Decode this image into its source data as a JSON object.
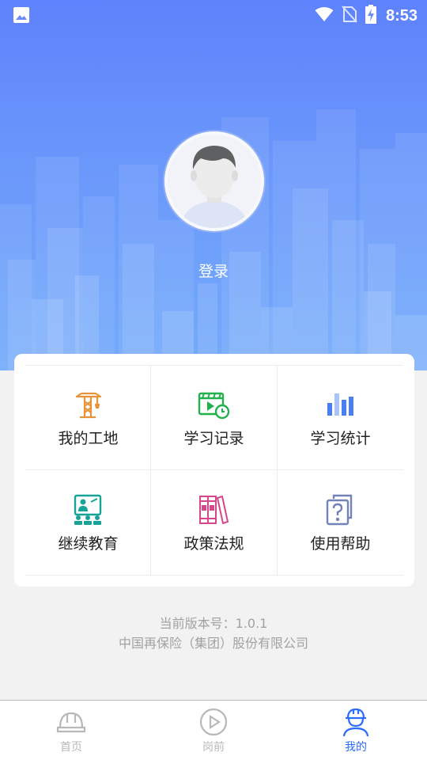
{
  "status_bar": {
    "time": "8:53",
    "icons": [
      "image-icon",
      "wifi-icon",
      "no-sim-icon",
      "battery-charging-icon"
    ]
  },
  "profile": {
    "login_label": "登录",
    "avatar_icon": "default-avatar-icon"
  },
  "menu": {
    "items": [
      {
        "label": "我的工地",
        "icon": "crane-icon",
        "color": "#e8933a"
      },
      {
        "label": "学习记录",
        "icon": "video-clock-icon",
        "color": "#22b14c"
      },
      {
        "label": "学习统计",
        "icon": "bar-chart-icon",
        "color": "#4a7ff2"
      },
      {
        "label": "继续教育",
        "icon": "classroom-icon",
        "color": "#17a398"
      },
      {
        "label": "政策法规",
        "icon": "law-books-icon",
        "color": "#d8468a"
      },
      {
        "label": "使用帮助",
        "icon": "help-doc-icon",
        "color": "#7382b8"
      }
    ]
  },
  "footer": {
    "version": "当前版本号：1.0.1",
    "company": "中国再保险（集团）股份有限公司"
  },
  "tabbar": {
    "tabs": [
      {
        "label": "首页",
        "icon": "hardhat-icon",
        "active": false
      },
      {
        "label": "岗前",
        "icon": "play-circle-icon",
        "active": false
      },
      {
        "label": "我的",
        "icon": "worker-profile-icon",
        "active": true
      }
    ],
    "active_color": "#2b6bff",
    "inactive_color": "#b8b8b8"
  },
  "colors": {
    "header_top": "#5e82fb",
    "header_bottom": "#73abfb",
    "background": "#f2f2f2"
  }
}
